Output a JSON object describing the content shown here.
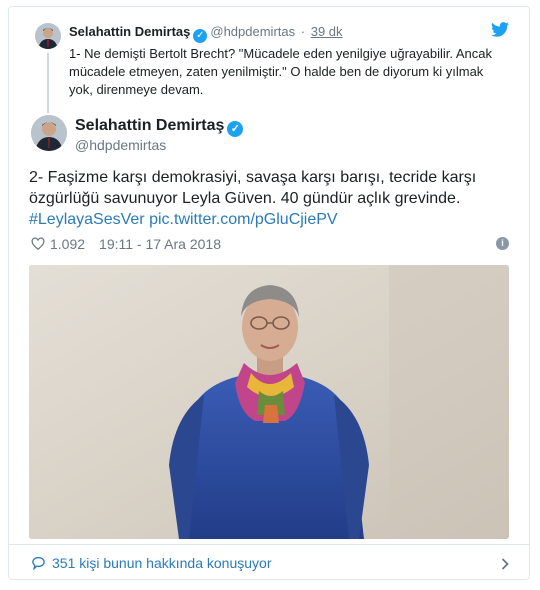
{
  "parent_tweet": {
    "name": "Selahattin Demirtaş",
    "handle": "@hdpdemirtas",
    "separator": "·",
    "time": "39 dk",
    "text": "1- Ne demişti Bertolt Brecht? \"Mücadele eden yenilgiye uğrayabilir. Ancak mücadele etmeyen, zaten yenilmiştir.\" O halde ben de diyorum ki yılmak yok, direnmeye devam."
  },
  "main_tweet": {
    "name": "Selahattin Demirtaş",
    "handle": "@hdpdemirtas",
    "text": "2- Faşizme karşı demokrasiyi, savaşa karşı barışı, tecride karşı özgürlüğü savunuyor Leyla Güven. 40 gündür açlık grevinde.",
    "hashtag": "#LeylayaSesVer",
    "link": "pic.twitter.com/pGluCjiePV",
    "likes": "1.092",
    "timestamp": "19:11 - 17 Ara 2018"
  },
  "footer": {
    "label": "351 kişi bunun hakkında konuşuyor"
  },
  "icons": [
    "twitter-bird-icon",
    "verified-icon",
    "heart-icon",
    "info-icon",
    "speech-bubble-icon",
    "chevron-right-icon"
  ],
  "colors": {
    "link": "#2b7bb9",
    "verified": "#1da1f2",
    "muted": "#697882",
    "border": "#e1e8ed",
    "sweater": "#2f4fa3"
  }
}
